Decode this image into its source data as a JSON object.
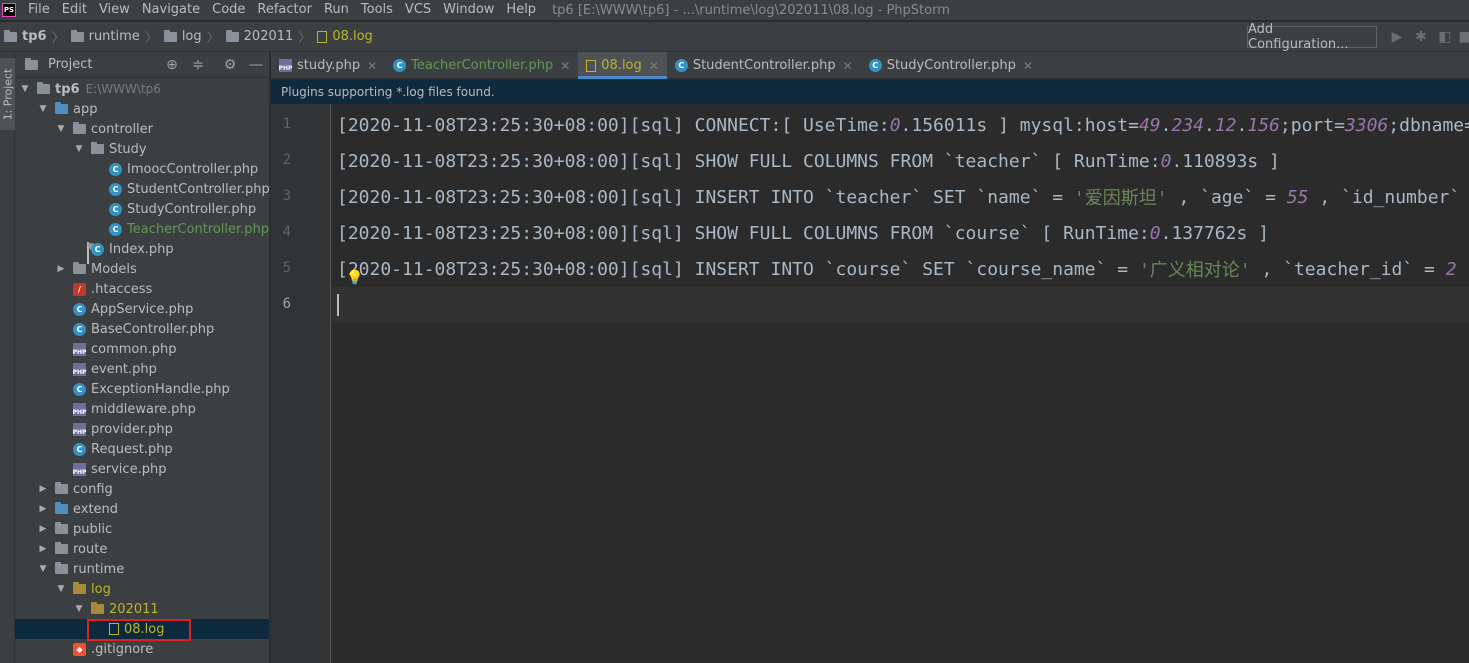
{
  "menubar": {
    "logo": "PS",
    "items": [
      "File",
      "Edit",
      "View",
      "Navigate",
      "Code",
      "Refactor",
      "Run",
      "Tools",
      "VCS",
      "Window",
      "Help"
    ],
    "title": "tp6 [E:\\WWW\\tp6] - ...\\runtime\\log\\202011\\08.log - PhpStorm"
  },
  "navbar": {
    "crumbs": [
      "tp6",
      "runtime",
      "log",
      "202011",
      "08.log"
    ],
    "add_configuration": "Add Configuration..."
  },
  "stripe": {
    "project_tab": "1: Project"
  },
  "project_panel": {
    "title": "Project",
    "tree": [
      {
        "label": "tp6",
        "extra": "E:\\WWW\\tp6",
        "icon": "folder",
        "depth": 0,
        "expanded": true
      },
      {
        "label": "app",
        "icon": "folder-blue",
        "depth": 1,
        "expanded": true
      },
      {
        "label": "controller",
        "icon": "folder",
        "depth": 2,
        "expanded": true
      },
      {
        "label": "Study",
        "icon": "folder",
        "depth": 3,
        "expanded": true
      },
      {
        "label": "ImoocController.php",
        "icon": "class",
        "depth": 4
      },
      {
        "label": "StudentController.php",
        "icon": "class",
        "depth": 4
      },
      {
        "label": "StudyController.php",
        "icon": "class",
        "depth": 4
      },
      {
        "label": "TeacherController.php",
        "icon": "class",
        "depth": 4,
        "color": "green"
      },
      {
        "label": "Index.php",
        "icon": "class",
        "depth": 3
      },
      {
        "label": "Models",
        "icon": "folder",
        "depth": 2,
        "expanded": false
      },
      {
        "label": ".htaccess",
        "icon": "htaccess",
        "depth": 2
      },
      {
        "label": "AppService.php",
        "icon": "class",
        "depth": 2
      },
      {
        "label": "BaseController.php",
        "icon": "class",
        "depth": 2
      },
      {
        "label": "common.php",
        "icon": "php",
        "depth": 2
      },
      {
        "label": "event.php",
        "icon": "php",
        "depth": 2
      },
      {
        "label": "ExceptionHandle.php",
        "icon": "class",
        "depth": 2
      },
      {
        "label": "middleware.php",
        "icon": "php",
        "depth": 2
      },
      {
        "label": "provider.php",
        "icon": "php",
        "depth": 2
      },
      {
        "label": "Request.php",
        "icon": "class",
        "depth": 2
      },
      {
        "label": "service.php",
        "icon": "php",
        "depth": 2
      },
      {
        "label": "config",
        "icon": "folder",
        "depth": 1,
        "expanded": false
      },
      {
        "label": "extend",
        "icon": "folder-blue",
        "depth": 1,
        "expanded": false
      },
      {
        "label": "public",
        "icon": "folder",
        "depth": 1,
        "expanded": false
      },
      {
        "label": "route",
        "icon": "folder",
        "depth": 1,
        "expanded": false
      },
      {
        "label": "runtime",
        "icon": "folder",
        "depth": 1,
        "expanded": true
      },
      {
        "label": "log",
        "icon": "folder-yellow",
        "depth": 2,
        "expanded": true,
        "color": "yellow"
      },
      {
        "label": "202011",
        "icon": "folder-yellow",
        "depth": 3,
        "expanded": true,
        "color": "yellow"
      },
      {
        "label": "08.log",
        "icon": "file",
        "depth": 4,
        "color": "yellow",
        "selected": true,
        "highlighted": true
      },
      {
        "label": ".gitignore",
        "icon": "git",
        "depth": 2
      }
    ]
  },
  "tabs": [
    {
      "label": "study.php",
      "icon": "php"
    },
    {
      "label": "TeacherController.php",
      "icon": "class",
      "color": "green"
    },
    {
      "label": "08.log",
      "icon": "file",
      "color": "yellow",
      "active": true
    },
    {
      "label": "StudentController.php",
      "icon": "class"
    },
    {
      "label": "StudyController.php",
      "icon": "class"
    }
  ],
  "banner": "Plugins supporting *.log files found.",
  "editor": {
    "current_line": 6,
    "lines": [
      [
        {
          "t": "[2020-11-08T23:25:30+08:00][sql] CONNECT:[ UseTime:"
        },
        {
          "t": "0",
          "c": "num2"
        },
        {
          "t": ".156011s ] mysql:host="
        },
        {
          "t": "49",
          "c": "num2"
        },
        {
          "t": "."
        },
        {
          "t": "234",
          "c": "num2"
        },
        {
          "t": "."
        },
        {
          "t": "12",
          "c": "num2"
        },
        {
          "t": "."
        },
        {
          "t": "156",
          "c": "num2"
        },
        {
          "t": ";port="
        },
        {
          "t": "3306",
          "c": "num2"
        },
        {
          "t": ";dbname="
        }
      ],
      [
        {
          "t": "[2020-11-08T23:25:30+08:00][sql] SHOW FULL COLUMNS FROM `teacher` [ RunTime:"
        },
        {
          "t": "0",
          "c": "num2"
        },
        {
          "t": ".110893s ]"
        }
      ],
      [
        {
          "t": "[2020-11-08T23:25:30+08:00][sql] INSERT INTO `teacher` SET `name` = "
        },
        {
          "t": "'爱因斯坦'",
          "c": "str"
        },
        {
          "t": " , `age` = "
        },
        {
          "t": "55",
          "c": "num2"
        },
        {
          "t": " , `id_number` ="
        }
      ],
      [
        {
          "t": "[2020-11-08T23:25:30+08:00][sql] SHOW FULL COLUMNS FROM `course` [ RunTime:"
        },
        {
          "t": "0",
          "c": "num2"
        },
        {
          "t": ".137762s ]"
        }
      ],
      [
        {
          "t": "[2020-11-08T23:25:30+08:00][sql] INSERT INTO `course` SET `course_name` = "
        },
        {
          "t": "'广义相对论'",
          "c": "str"
        },
        {
          "t": " , `teacher_id` = "
        },
        {
          "t": "2",
          "c": "num2"
        }
      ],
      []
    ]
  }
}
